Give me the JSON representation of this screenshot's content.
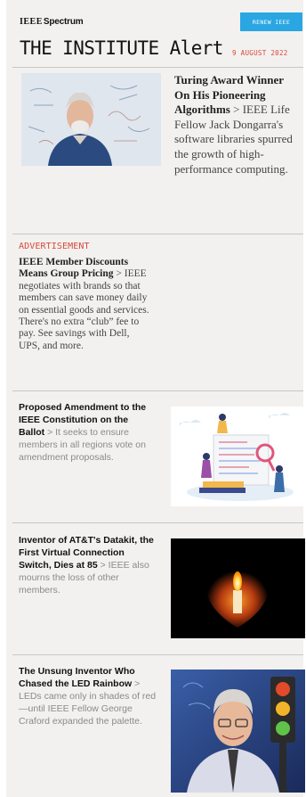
{
  "header": {
    "brand_ieee": "IEEE",
    "brand_name": "Spectrum",
    "renew_label": "RENEW IEEE",
    "title": "THE INSTITUTE Alert",
    "date": "9 AUGUST 2022"
  },
  "colors": {
    "accent_blue": "#2aa6e3",
    "accent_red": "#d9483b",
    "background": "#f2f1ef"
  },
  "lead_story": {
    "headline": "Turing Award Winner On His Pioneering Algorithms",
    "separator": " > ",
    "summary": "IEEE Life Fellow Jack Dongarra's software libraries spurred the growth of high-performance computing."
  },
  "advertisement": {
    "label": "ADVERTISEMENT",
    "headline": "IEEE Member Discounts Means Group Pricing",
    "separator": " > ",
    "summary": "IEEE negotiates with brands so that members can save money daily on essential goods and services. There's no extra “club” fee to pay. See savings with Dell, UPS, and more."
  },
  "stories": [
    {
      "headline": "Proposed Amendment to the IEEE Constitution on the Ballot",
      "separator": " > ",
      "summary": "It seeks to ensure members in all regions vote on amendment proposals."
    },
    {
      "headline": "Inventor of AT&T's Datakit, the First Virtual Connection Switch, Dies at 85",
      "separator": " > ",
      "summary": "IEEE also mourns the loss of other members."
    },
    {
      "headline": "The Unsung Inventor Who Chased the LED Rainbow",
      "separator": " > ",
      "summary": "LEDs came only in shades of red—until IEEE Fellow George Craford expanded the palette."
    }
  ]
}
